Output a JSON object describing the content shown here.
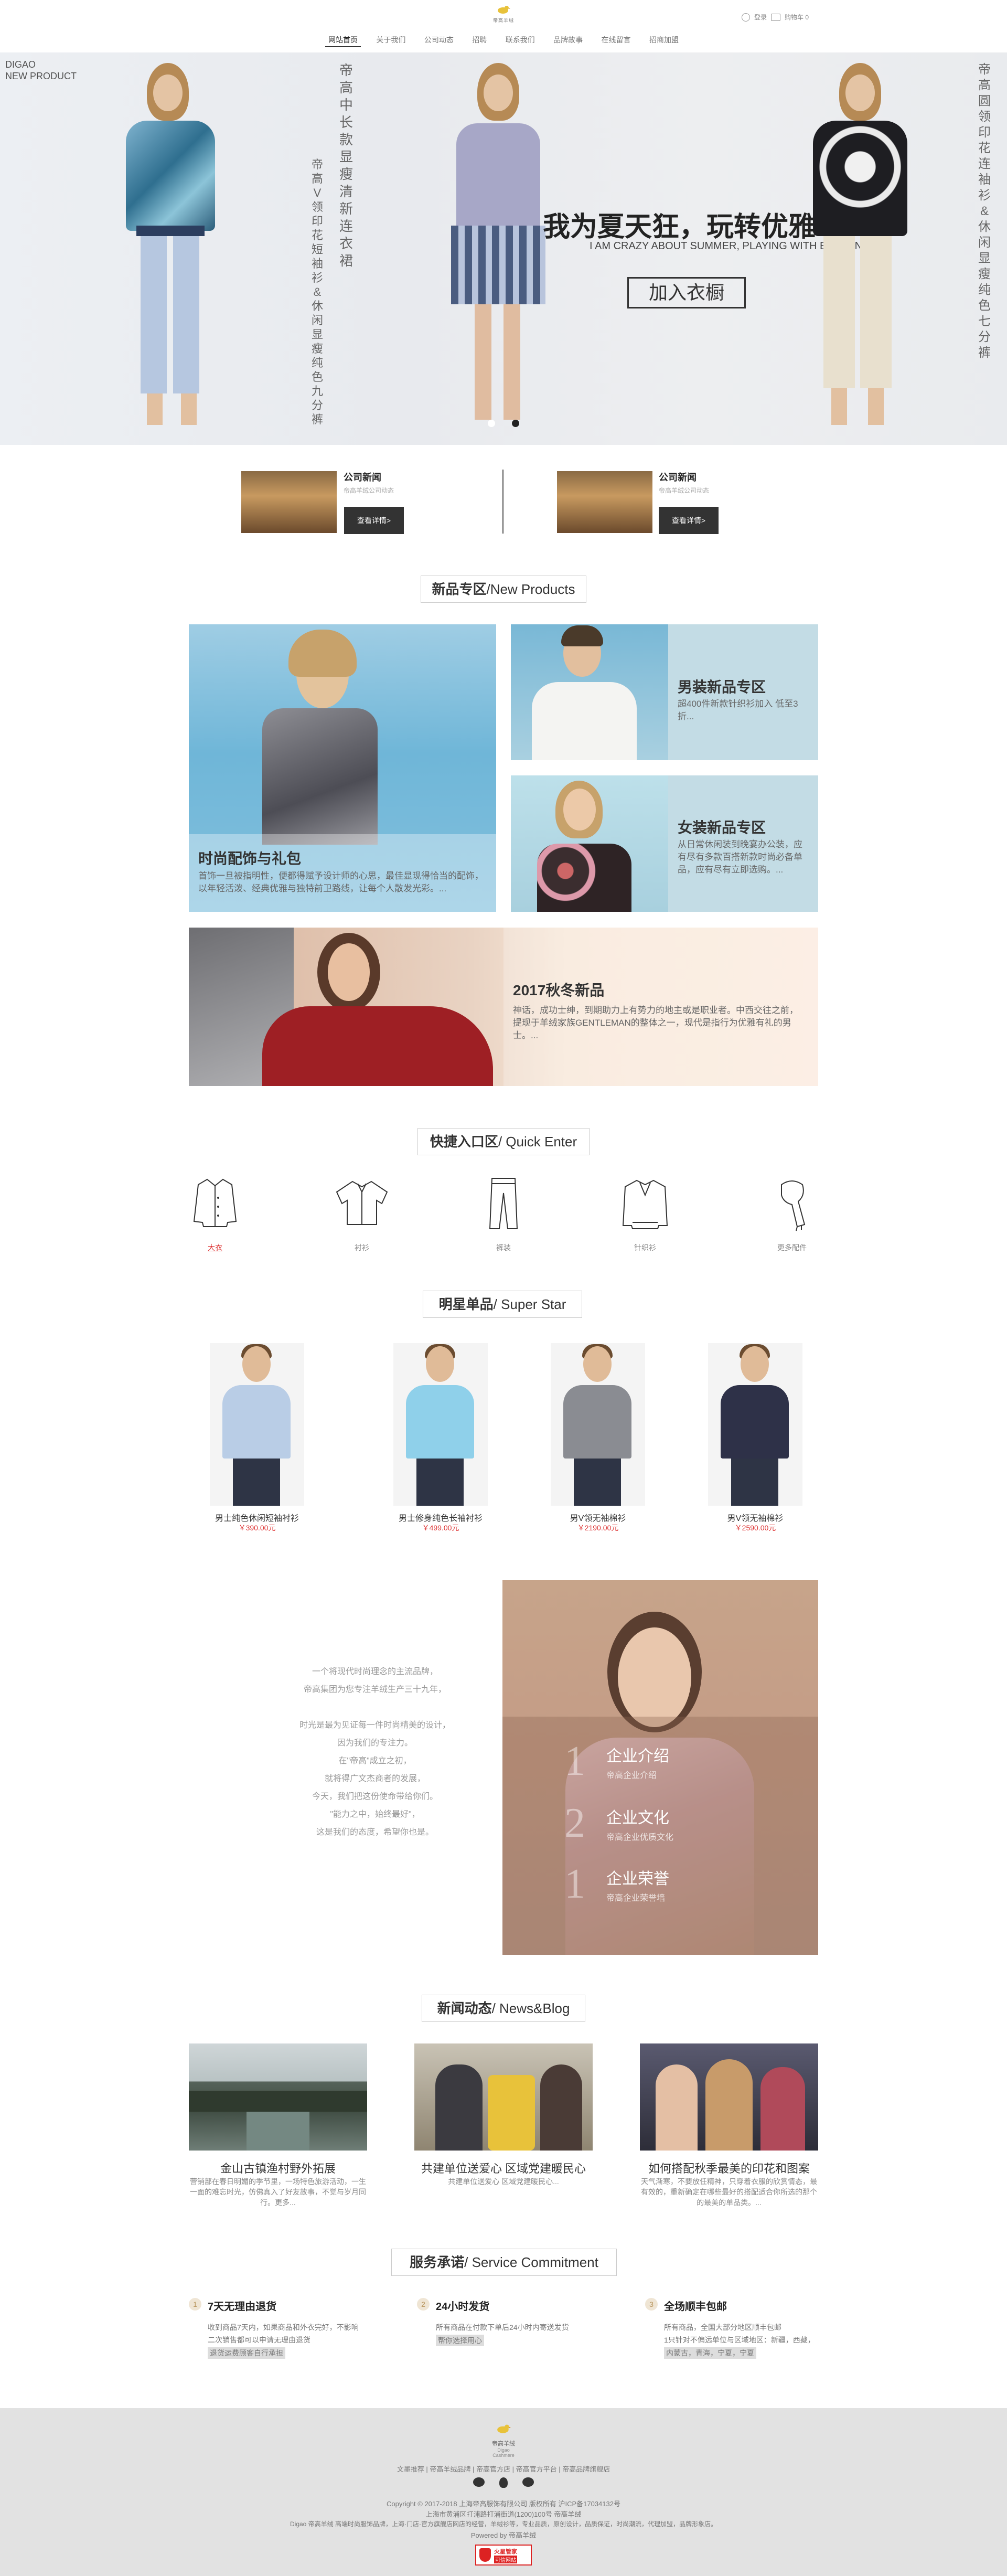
{
  "header": {
    "logo_text": "帝高羊绒",
    "nav": [
      "网站首页",
      "关于我们",
      "公司动态",
      "招聘",
      "联系我们",
      "品牌故事",
      "在线留言",
      "招商加盟"
    ],
    "login": "登录",
    "cart": "购物车 0"
  },
  "banner": {
    "corner_line1": "DIGAO",
    "corner_line2": "NEW PRODUCT",
    "vtext_1": "帝高中长款显瘦清新连衣裙",
    "vtext_2": "帝高V领印花短袖衫&休闲显瘦纯色九分裤",
    "vtext_3": "帝高圆领印花连袖衫&休闲显瘦纯色七分裤",
    "title": "我为夏天狂，玩转优雅",
    "subtitle": "I AM CRAZY ABOUT SUMMER, PLAYING WITH ELEGANCE.",
    "button": "加入衣橱"
  },
  "news_strip": [
    {
      "title": "公司新闻",
      "desc": "帝高羊绒公司动态",
      "button": "查看详情>"
    },
    {
      "title": "公司新闻",
      "desc": "帝高羊绒公司动态",
      "button": "查看详情>"
    }
  ],
  "new_products": {
    "heading_cn": "新品专区",
    "heading_en": "/New Products",
    "accessories_title": "时尚配饰与礼包",
    "accessories_text": "首饰一旦被指明性，便都得赋予设计师的心思，最佳显现得恰当的配饰，以年轻活泼、经典优雅与独特前卫路线，让每个人散发光彩。...",
    "men_title": "男装新品专区",
    "men_text": "超400件新款针织衫加入 低至3折...",
    "women_title": "女装新品专区",
    "women_text": "从日常休闲装到晚宴办公装，应有尽有多款百搭新款时尚必备单品，应有尽有立即选购。...",
    "autumn_title": "2017秋冬新品",
    "autumn_text": "神话，成功士绅，到期助力上有势力的地主或是职业者。中西交往之前，提现于羊绒家族GENTLEMAN的整体之一，现代是指行为优雅有礼的男士。..."
  },
  "quick_enter": {
    "heading_cn": "快捷入口区",
    "heading_en": "/ Quick Enter",
    "items": [
      "大衣",
      "衬衫",
      "裤装",
      "针织衫",
      "更多配件"
    ]
  },
  "super_star": {
    "heading_cn": "明星单品",
    "heading_en": "/ Super Star",
    "items": [
      {
        "name": "男士纯色休闲短袖衬衫",
        "price": "￥390.00元",
        "color": "#b9cde6"
      },
      {
        "name": "男士修身纯色长袖衬衫",
        "price": "￥499.00元",
        "color": "#8fd0ea"
      },
      {
        "name": "男V领无袖棉衫",
        "price": "￥2190.00元",
        "color": "#8a8c92"
      },
      {
        "name": "男V领无袖棉衫",
        "price": "￥2590.00元",
        "color": "#2e3148"
      }
    ]
  },
  "about": {
    "lines": [
      "一个将现代时尚理念的主流品牌，",
      "帝高集团为您专注羊绒生产三十九年，",
      "",
      "时光是最为见证每一件时尚精美的设计，",
      "因为我们的专注力。",
      "在\"帝高\"成立之初，",
      "就将得广文杰商者的发展，",
      "今天，我们把这份使命带给你们。",
      "\"能力之中，始终最好\"，",
      "这是我们的态度，希望你也是。"
    ],
    "items": [
      {
        "num": "1",
        "title": "企业介绍",
        "sub": "帝高企业介绍"
      },
      {
        "num": "2",
        "title": "企业文化",
        "sub": "帝高企业优质文化"
      },
      {
        "num": "1",
        "title": "企业荣誉",
        "sub": "帝高企业荣誉墙"
      }
    ]
  },
  "blog": {
    "heading_cn": "新闻动态",
    "heading_en": "/ News&Blog",
    "items": [
      {
        "title": "金山古镇渔村野外拓展",
        "text": "营销部在春日明媚的季节里，一场特色旅游活动，一生一面的难忘时光，仿佛真入了好友故事，不觉与岁月同行。更多..."
      },
      {
        "title": "共建单位送爱心 区域党建暖民心",
        "text": "共建单位送爱心 区域党建暖民心..."
      },
      {
        "title": "如何搭配秋季最美的印花和图案",
        "text": "天气渐寒，不要放任精神，只穿着衣服的欣赏情态，最有效的，重新确定在哪些最好的搭配适合你所选的那个的最美的单品类。..."
      }
    ]
  },
  "service": {
    "heading_cn": "服务承诺",
    "heading_en": "/ Service Commitment",
    "items": [
      {
        "num": "1",
        "title": "7天无理由退货",
        "lines": [
          "收到商品7天内，如果商品和外衣完好，不影响",
          "二次销售都可以申请无理由退货",
          "退货运费顾客自行承担"
        ]
      },
      {
        "num": "2",
        "title": "24小时发货",
        "lines": [
          "所有商品在付款下单后24小时内寄送发货",
          "帮你选择用心"
        ]
      },
      {
        "num": "3",
        "title": "全场顺丰包邮",
        "lines": [
          "所有商品，全国大部分地区顺丰包邮",
          "1只针对不偏远单位与区域地区：新疆，西藏，",
          "内蒙古，青海，宁夏，宁夏"
        ]
      }
    ]
  },
  "footer": {
    "logo_text": "帝高羊绒",
    "logo_sub": "Digao Cashmere",
    "links": "文墨推荐 | 帝高羊绒品牌 | 帝高官方店 | 帝高官方平台 | 帝高品牌旗舰店",
    "copyright": "Copyright © 2017-2018 上海帝高服饰有限公司 版权所有 沪ICP备17034132号",
    "address": "上海市黄浦区打浦路打浦街道(1200)100号 帝高羊绒",
    "desc": "Digao 帝高羊绒 高端时尚服饰品牌，上海·门店·官方旗舰店网店的经营，羊绒衫等，专业品质，原创设计，品质保证，时尚潮流，代理加盟，品牌形象店。",
    "powered": "Powered by 帝高羊绒",
    "badge_line1": "火星管家",
    "badge_line2": "可信网站"
  }
}
